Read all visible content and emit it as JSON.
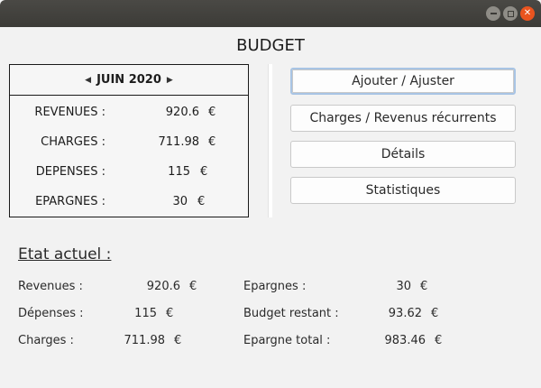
{
  "window": {
    "controls": [
      "minimize-icon",
      "maximize-icon",
      "close-icon"
    ]
  },
  "app": {
    "title": "BUDGET"
  },
  "month_panel": {
    "month": "JUIN 2020",
    "rows": [
      {
        "label": "REVENUES :",
        "value": "920.6",
        "currency": "€"
      },
      {
        "label": "CHARGES :",
        "value": "711.98",
        "currency": "€"
      },
      {
        "label": "DEPENSES :",
        "value": "115",
        "currency": "€"
      },
      {
        "label": "EPARGNES :",
        "value": "30",
        "currency": "€"
      }
    ]
  },
  "actions": {
    "ajouter": "Ajouter / Ajuster",
    "charges": "Charges / Revenus récurrents",
    "details": "Détails",
    "statistiques": "Statistiques"
  },
  "etat": {
    "title": "Etat actuel :",
    "left": [
      {
        "label": "Revenues :",
        "value": "920.6",
        "currency": "€"
      },
      {
        "label": "Dépenses :",
        "value": "115",
        "currency": "€"
      },
      {
        "label": "Charges :",
        "value": "711.98",
        "currency": "€"
      }
    ],
    "right": [
      {
        "label": "Epargnes :",
        "value": "30",
        "currency": "€"
      },
      {
        "label": "Budget restant :",
        "value": "93.62",
        "currency": "€"
      },
      {
        "label": "Epargne total :",
        "value": "983.46",
        "currency": "€"
      }
    ]
  }
}
